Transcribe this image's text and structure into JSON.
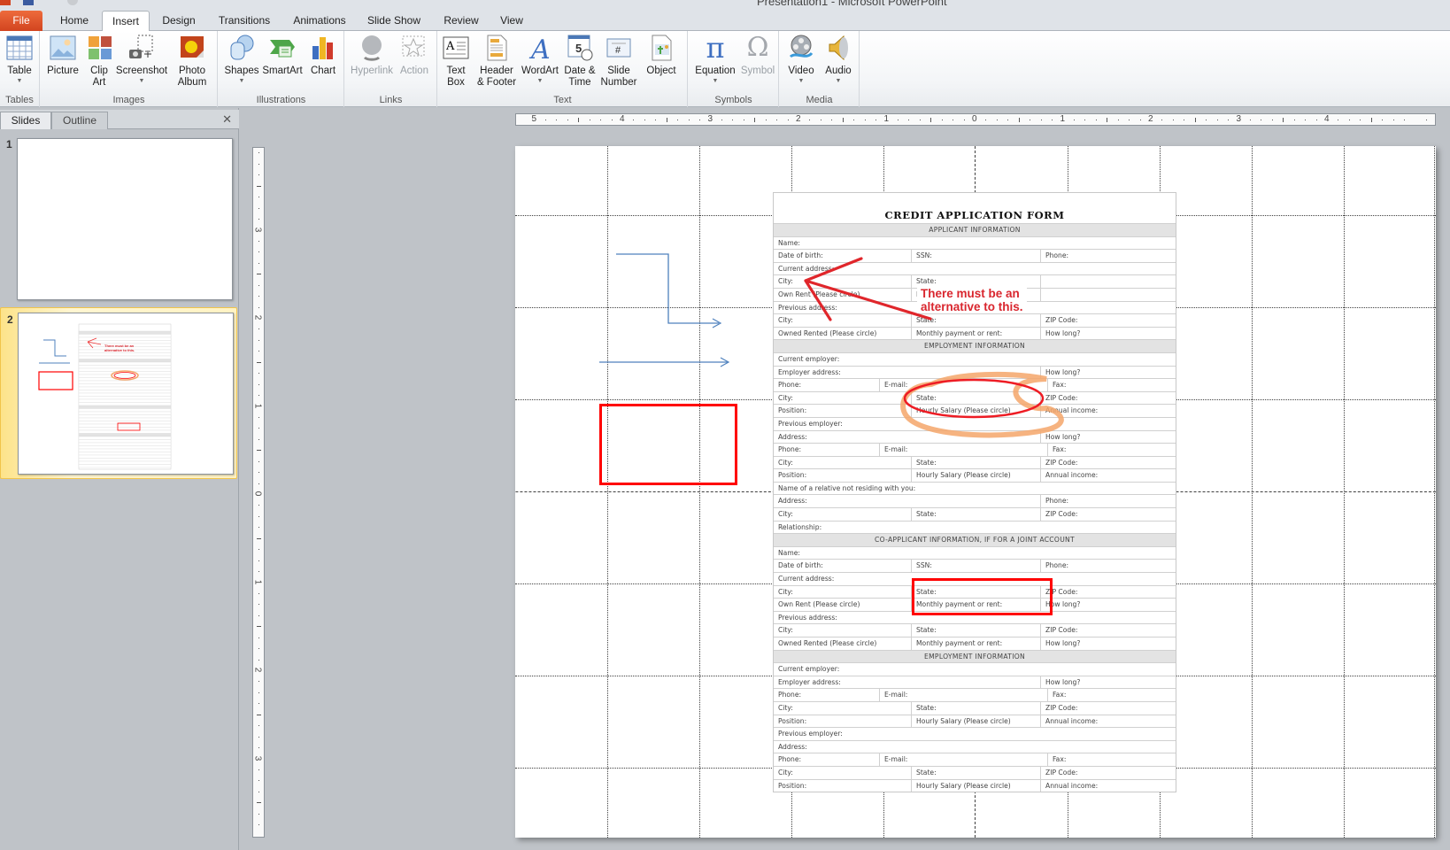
{
  "window": {
    "title": "Presentation1 - Microsoft PowerPoint"
  },
  "ribbon_tabs": [
    {
      "label": "File"
    },
    {
      "label": "Home"
    },
    {
      "label": "Insert",
      "active": true
    },
    {
      "label": "Design"
    },
    {
      "label": "Transitions"
    },
    {
      "label": "Animations"
    },
    {
      "label": "Slide Show"
    },
    {
      "label": "Review"
    },
    {
      "label": "View"
    }
  ],
  "ribbon_groups": {
    "tables": {
      "label": "Tables",
      "buttons": [
        {
          "label": "Table",
          "icon": "table-icon"
        }
      ]
    },
    "images": {
      "label": "Images",
      "buttons": [
        {
          "label": "Picture",
          "icon": "picture-icon"
        },
        {
          "label": "Clip Art",
          "icon": "clip-art-icon"
        },
        {
          "label": "Screenshot",
          "icon": "screenshot-icon"
        },
        {
          "label": "Photo Album",
          "icon": "photo-album-icon"
        }
      ]
    },
    "illustrations": {
      "label": "Illustrations",
      "buttons": [
        {
          "label": "Shapes",
          "icon": "shapes-icon"
        },
        {
          "label": "SmartArt",
          "icon": "smartart-icon"
        },
        {
          "label": "Chart",
          "icon": "chart-icon"
        }
      ]
    },
    "links": {
      "label": "Links",
      "buttons": [
        {
          "label": "Hyperlink",
          "icon": "hyperlink-icon",
          "disabled": true
        },
        {
          "label": "Action",
          "icon": "action-icon",
          "disabled": true
        }
      ]
    },
    "text": {
      "label": "Text",
      "buttons": [
        {
          "label": "Text Box",
          "icon": "text-box-icon"
        },
        {
          "label": "Header & Footer",
          "icon": "header-footer-icon"
        },
        {
          "label": "WordArt",
          "icon": "wordart-icon"
        },
        {
          "label": "Date & Time",
          "icon": "date-time-icon"
        },
        {
          "label": "Slide Number",
          "icon": "slide-number-icon"
        },
        {
          "label": "Object",
          "icon": "object-icon"
        }
      ]
    },
    "symbols": {
      "label": "Symbols",
      "buttons": [
        {
          "label": "Equation",
          "icon": "equation-icon"
        },
        {
          "label": "Symbol",
          "icon": "symbol-icon",
          "disabled": true
        }
      ]
    },
    "media": {
      "label": "Media",
      "buttons": [
        {
          "label": "Video",
          "icon": "video-icon"
        },
        {
          "label": "Audio",
          "icon": "audio-icon"
        }
      ]
    }
  },
  "left_pane": {
    "tabs": [
      {
        "label": "Slides",
        "active": true
      },
      {
        "label": "Outline"
      }
    ],
    "close_glyph": "✕",
    "slides": [
      {
        "number": "1",
        "selected": false
      },
      {
        "number": "2",
        "selected": true
      }
    ]
  },
  "rulers": {
    "horizontal_labels": [
      "5",
      "4",
      "3",
      "2",
      "1",
      "0",
      "1",
      "2",
      "3",
      "4"
    ],
    "vertical_labels": [
      "3",
      "2",
      "1",
      "0",
      "1",
      "2",
      "3"
    ]
  },
  "slide": {
    "annotation_text": [
      "There must be an",
      "alternative to this."
    ],
    "annotation_color": "#d9262e",
    "highlight_red": "#ff0000",
    "highlight_orange": "#f4a66a",
    "arrow_blue": "#4f81bd"
  },
  "form": {
    "title": "CREDIT APPLICATION FORM",
    "rows": [
      {
        "section": "APPLICANT INFORMATION"
      },
      {
        "cells": [
          "Name:"
        ]
      },
      {
        "cells": [
          "Date of birth:",
          "SSN:",
          "Phone:"
        ]
      },
      {
        "cells": [
          "Current address:"
        ]
      },
      {
        "cells": [
          "City:",
          "State:",
          ""
        ]
      },
      {
        "cells": [
          "Own      Rent      (Please circle)",
          "Monthly payment or rent:",
          ""
        ]
      },
      {
        "cells": [
          "Previous address:"
        ]
      },
      {
        "cells": [
          "City:",
          "State:",
          "ZIP Code:"
        ]
      },
      {
        "cells": [
          "Owned  Rented  (Please circle)",
          "Monthly payment or rent:",
          "How long?"
        ]
      },
      {
        "section": "EMPLOYMENT INFORMATION"
      },
      {
        "cells": [
          "Current employer:"
        ]
      },
      {
        "cells": [
          "Employer address:",
          "How long?"
        ],
        "layout": "addr"
      },
      {
        "cells": [
          "Phone:",
          "E-mail:",
          "Fax:"
        ],
        "layout": "phone"
      },
      {
        "cells": [
          "City:",
          "State:",
          "ZIP Code:"
        ]
      },
      {
        "cells": [
          "Position:",
          "Hourly    Salary   (Please circle)",
          "Annual income:"
        ]
      },
      {
        "cells": [
          "Previous employer:"
        ]
      },
      {
        "cells": [
          "Address:",
          "How long?"
        ],
        "layout": "addr"
      },
      {
        "cells": [
          "Phone:",
          "E-mail:",
          "Fax:"
        ],
        "layout": "phone"
      },
      {
        "cells": [
          "City:",
          "State:",
          "ZIP Code:"
        ]
      },
      {
        "cells": [
          "Position:",
          "Hourly   Salary    (Please circle)",
          "Annual income:"
        ]
      },
      {
        "cells": [
          "Name of a relative not residing with you:"
        ]
      },
      {
        "cells": [
          "Address:",
          "Phone:"
        ],
        "layout": "addr"
      },
      {
        "cells": [
          "City:",
          "State:",
          "ZIP Code:"
        ]
      },
      {
        "cells": [
          "Relationship:"
        ]
      },
      {
        "section": "CO-APPLICANT INFORMATION, IF FOR A JOINT ACCOUNT"
      },
      {
        "cells": [
          "Name:"
        ]
      },
      {
        "cells": [
          "Date of birth:",
          "SSN:",
          "Phone:"
        ]
      },
      {
        "cells": [
          "Current address:"
        ]
      },
      {
        "cells": [
          "City:",
          "State:",
          "ZIP Code:"
        ]
      },
      {
        "cells": [
          "Own      Rent      (Please circle)",
          "Monthly payment or rent:",
          "How long?"
        ]
      },
      {
        "cells": [
          "Previous address:"
        ]
      },
      {
        "cells": [
          "City:",
          "State:",
          "ZIP Code:"
        ]
      },
      {
        "cells": [
          "Owned  Rented  (Please circle)",
          "Monthly payment or rent:",
          "How long?"
        ]
      },
      {
        "section": "EMPLOYMENT INFORMATION"
      },
      {
        "cells": [
          "Current employer:"
        ]
      },
      {
        "cells": [
          "Employer address:",
          "How long?"
        ],
        "layout": "addr"
      },
      {
        "cells": [
          "Phone:",
          "E-mail:",
          "Fax:"
        ],
        "layout": "phone"
      },
      {
        "cells": [
          "City:",
          "State:",
          "ZIP Code:"
        ]
      },
      {
        "cells": [
          "Position:",
          "Hourly    Salary   (Please circle)",
          "Annual income:"
        ]
      },
      {
        "cells": [
          "Previous employer:"
        ]
      },
      {
        "cells": [
          "Address:"
        ]
      },
      {
        "cells": [
          "Phone:",
          "E-mail:",
          "Fax:"
        ],
        "layout": "phone"
      },
      {
        "cells": [
          "City:",
          "State:",
          "ZIP Code:"
        ]
      },
      {
        "cells": [
          "Position:",
          "Hourly   Salary    (Please circle)",
          "Annual income:"
        ]
      }
    ]
  }
}
